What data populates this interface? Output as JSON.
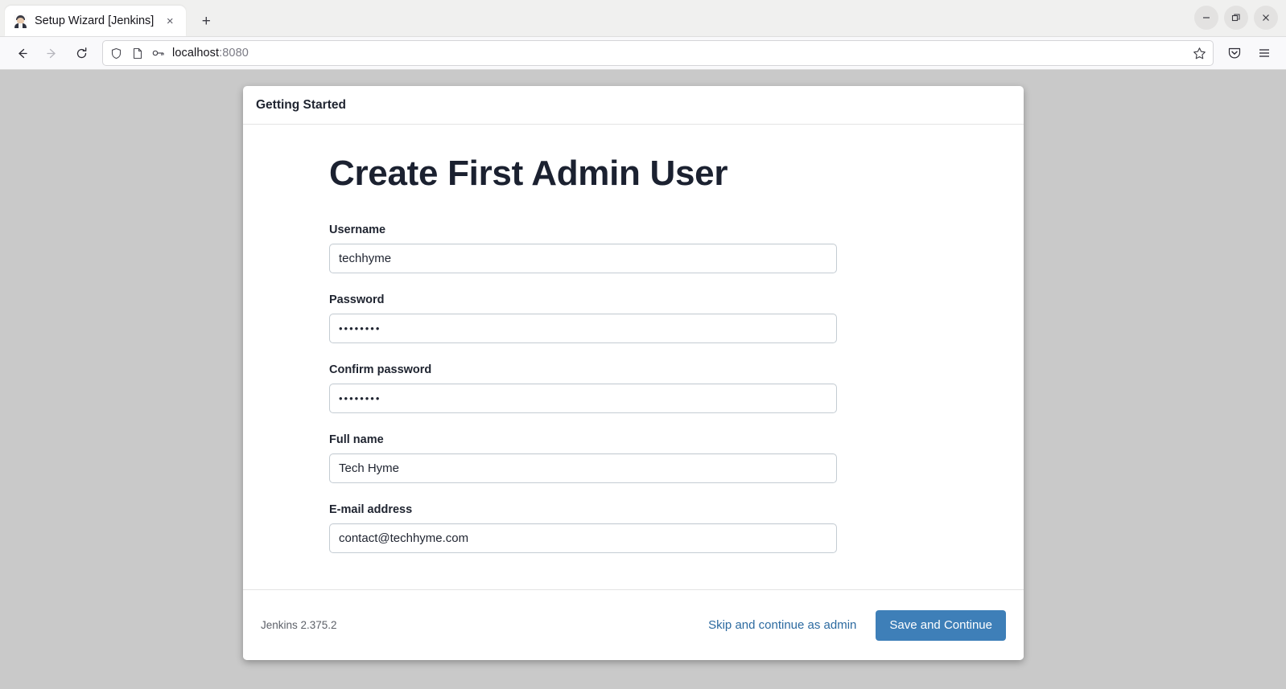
{
  "browser": {
    "tab": {
      "title": "Setup Wizard [Jenkins]",
      "favicon": "jenkins-butler-icon",
      "close_label": "×"
    },
    "new_tab_label": "+",
    "window_controls": {
      "minimize": "minimize-icon",
      "restore": "restore-icon",
      "close": "close-icon"
    },
    "nav": {
      "back": "back-arrow-icon",
      "forward": "forward-arrow-icon",
      "reload": "reload-icon"
    },
    "urlbar": {
      "shield_icon": "shield-icon",
      "page_icon": "page-icon",
      "key_icon": "key-icon",
      "host": "localhost",
      "port": ":8080",
      "bookmark_icon": "star-icon"
    },
    "toolbar": {
      "pocket_icon": "pocket-icon",
      "menu_icon": "hamburger-menu-icon"
    }
  },
  "card": {
    "header_title": "Getting Started",
    "page_title": "Create First Admin User",
    "fields": [
      {
        "name": "username",
        "label": "Username",
        "value": "techhyme",
        "type": "text"
      },
      {
        "name": "password",
        "label": "Password",
        "value": "••••••••",
        "type": "password"
      },
      {
        "name": "confirm-password",
        "label": "Confirm password",
        "value": "••••••••",
        "type": "password"
      },
      {
        "name": "full-name",
        "label": "Full name",
        "value": "Tech Hyme",
        "type": "text"
      },
      {
        "name": "email",
        "label": "E-mail address",
        "value": "contact@techhyme.com",
        "type": "text"
      }
    ],
    "footer": {
      "version": "Jenkins 2.375.2",
      "skip_label": "Skip and continue as admin",
      "save_label": "Save and Continue"
    }
  },
  "colors": {
    "primary_button": "#3e7fb8",
    "link": "#2c6aa0",
    "page_background": "#c9c9c9",
    "heading": "#1b2130"
  }
}
